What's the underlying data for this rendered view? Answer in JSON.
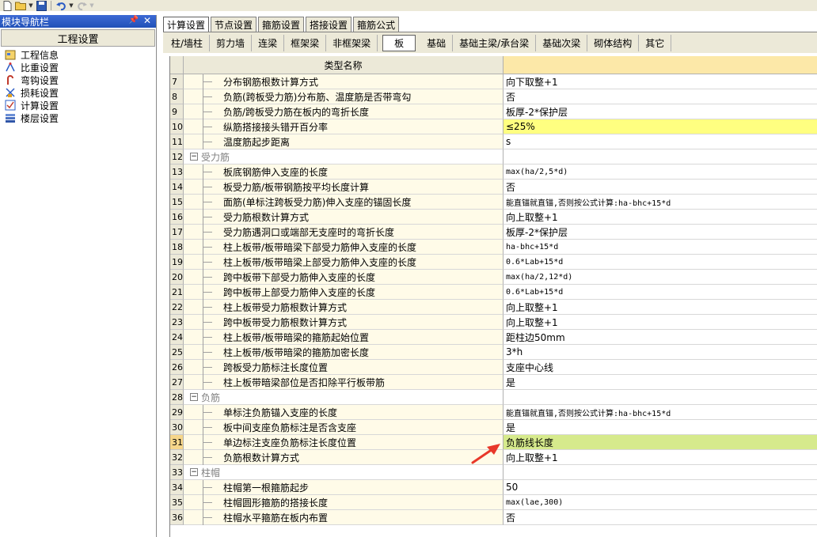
{
  "nav": {
    "title": "模块导航栏",
    "header": "工程设置",
    "items": [
      {
        "label": "工程信息",
        "icon": "project-info-icon"
      },
      {
        "label": "比重设置",
        "icon": "weight-settings-icon"
      },
      {
        "label": "弯钩设置",
        "icon": "hook-settings-icon"
      },
      {
        "label": "损耗设置",
        "icon": "loss-settings-icon"
      },
      {
        "label": "计算设置",
        "icon": "calc-settings-icon"
      },
      {
        "label": "楼层设置",
        "icon": "floor-settings-icon"
      }
    ]
  },
  "tabs_top": [
    "计算设置",
    "节点设置",
    "箍筋设置",
    "搭接设置",
    "箍筋公式"
  ],
  "tabs_second": [
    "柱/墙柱",
    "剪力墙",
    "连梁",
    "框架梁",
    "非框架梁",
    "板",
    "基础",
    "基础主梁/承台梁",
    "基础次梁",
    "砌体结构",
    "其它"
  ],
  "grid": {
    "header_name": "类型名称",
    "rows": [
      {
        "num": "7",
        "name": "分布钢筋根数计算方式",
        "value": "向下取整+1"
      },
      {
        "num": "8",
        "name": "负筋(跨板受力筋)分布筋、温度筋是否带弯勾",
        "value": "否"
      },
      {
        "num": "9",
        "name": "负筋/跨板受力筋在板内的弯折长度",
        "value": "板厚-2*保护层"
      },
      {
        "num": "10",
        "name": "纵筋搭接接头错开百分率",
        "value": "≤25%"
      },
      {
        "num": "11",
        "name": "温度筋起步距离",
        "value": "s"
      },
      {
        "num": "12",
        "name": "受力筋",
        "value": ""
      },
      {
        "num": "13",
        "name": "板底钢筋伸入支座的长度",
        "value": "max(ha/2,5*d)"
      },
      {
        "num": "14",
        "name": "板受力筋/板带钢筋按平均长度计算",
        "value": "否"
      },
      {
        "num": "15",
        "name": "面筋(单标注跨板受力筋)伸入支座的锚固长度",
        "value": "能直锚就直锚,否则按公式计算:ha-bhc+15*d"
      },
      {
        "num": "16",
        "name": "受力筋根数计算方式",
        "value": "向上取整+1"
      },
      {
        "num": "17",
        "name": "受力筋遇洞口或端部无支座时的弯折长度",
        "value": "板厚-2*保护层"
      },
      {
        "num": "18",
        "name": "柱上板带/板带暗梁下部受力筋伸入支座的长度",
        "value": "ha-bhc+15*d"
      },
      {
        "num": "19",
        "name": "柱上板带/板带暗梁上部受力筋伸入支座的长度",
        "value": "0.6*Lab+15*d"
      },
      {
        "num": "20",
        "name": "跨中板带下部受力筋伸入支座的长度",
        "value": "max(ha/2,12*d)"
      },
      {
        "num": "21",
        "name": "跨中板带上部受力筋伸入支座的长度",
        "value": "0.6*Lab+15*d"
      },
      {
        "num": "22",
        "name": "柱上板带受力筋根数计算方式",
        "value": "向上取整+1"
      },
      {
        "num": "23",
        "name": "跨中板带受力筋根数计算方式",
        "value": "向上取整+1"
      },
      {
        "num": "24",
        "name": "柱上板带/板带暗梁的箍筋起始位置",
        "value": "距柱边50mm"
      },
      {
        "num": "25",
        "name": "柱上板带/板带暗梁的箍筋加密长度",
        "value": "3*h"
      },
      {
        "num": "26",
        "name": "跨板受力筋标注长度位置",
        "value": "支座中心线"
      },
      {
        "num": "27",
        "name": "柱上板带暗梁部位是否扣除平行板带筋",
        "value": "是"
      },
      {
        "num": "28",
        "name": "负筋",
        "value": ""
      },
      {
        "num": "29",
        "name": "单标注负筋锚入支座的长度",
        "value": "能直锚就直锚,否则按公式计算:ha-bhc+15*d"
      },
      {
        "num": "30",
        "name": "板中间支座负筋标注是否含支座",
        "value": "是"
      },
      {
        "num": "31",
        "name": "单边标注支座负筋标注长度位置",
        "value": "负筋线长度"
      },
      {
        "num": "32",
        "name": "负筋根数计算方式",
        "value": "向上取整+1"
      },
      {
        "num": "33",
        "name": "柱帽",
        "value": ""
      },
      {
        "num": "34",
        "name": "柱帽第一根箍筋起步",
        "value": "50"
      },
      {
        "num": "35",
        "name": "柱帽圆形箍筋的搭接长度",
        "value": "max(lae,300)"
      },
      {
        "num": "36",
        "name": "柱帽水平箍筋在板内布置",
        "value": "否"
      }
    ]
  },
  "colors": {
    "header_bg": "#fce8a8",
    "highlight_yellow": "#ffff80",
    "highlight_green": "#d6ea8c",
    "arrow": "#e8382a"
  }
}
